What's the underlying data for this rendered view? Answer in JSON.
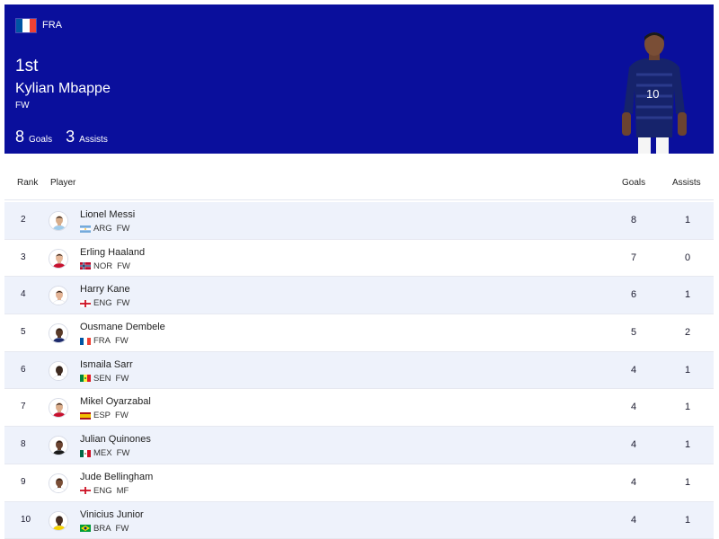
{
  "hero": {
    "country_code": "FRA",
    "rank": "1st",
    "name": "Kylian Mbappe",
    "position": "FW",
    "goals": "8",
    "goals_label": "Goals",
    "assists": "3",
    "assists_label": "Assists",
    "shirt_number": "10"
  },
  "table": {
    "headers": {
      "rank": "Rank",
      "player": "Player",
      "goals": "Goals",
      "assists": "Assists"
    },
    "rows": [
      {
        "rank": "2",
        "name": "Lionel Messi",
        "country": "ARG",
        "position": "FW",
        "goals": "8",
        "assists": "1",
        "flag": "ARG",
        "skin": "#d8ad8a",
        "shirt": "#9fcbea"
      },
      {
        "rank": "3",
        "name": "Erling Haaland",
        "country": "NOR",
        "position": "FW",
        "goals": "7",
        "assists": "0",
        "flag": "NOR",
        "skin": "#e6b89a",
        "shirt": "#c8102e"
      },
      {
        "rank": "4",
        "name": "Harry Kane",
        "country": "ENG",
        "position": "FW",
        "goals": "6",
        "assists": "1",
        "flag": "ENG",
        "skin": "#e3b394",
        "shirt": "#ffffff"
      },
      {
        "rank": "5",
        "name": "Ousmane Dembele",
        "country": "FRA",
        "position": "FW",
        "goals": "5",
        "assists": "2",
        "flag": "FRA",
        "skin": "#5a3a28",
        "shirt": "#1c2a6b"
      },
      {
        "rank": "6",
        "name": "Ismaila Sarr",
        "country": "SEN",
        "position": "FW",
        "goals": "4",
        "assists": "1",
        "flag": "SEN",
        "skin": "#3e2a20",
        "shirt": "#ffffff"
      },
      {
        "rank": "7",
        "name": "Mikel Oyarzabal",
        "country": "ESP",
        "position": "FW",
        "goals": "4",
        "assists": "1",
        "flag": "ESP",
        "skin": "#dcae8c",
        "shirt": "#c8102e"
      },
      {
        "rank": "8",
        "name": "Julian Quinones",
        "country": "MEX",
        "position": "FW",
        "goals": "4",
        "assists": "1",
        "flag": "MEX",
        "skin": "#6b4330",
        "shirt": "#1a1a1a"
      },
      {
        "rank": "9",
        "name": "Jude Bellingham",
        "country": "ENG",
        "position": "MF",
        "goals": "4",
        "assists": "1",
        "flag": "ENG",
        "skin": "#7a4e36",
        "shirt": "#ffffff"
      },
      {
        "rank": "10",
        "name": "Vinicius Junior",
        "country": "BRA",
        "position": "FW",
        "goals": "4",
        "assists": "1",
        "flag": "BRA",
        "skin": "#4a3024",
        "shirt": "#f5d200"
      }
    ]
  },
  "colors": {
    "hero_bg": "#0a0f9c",
    "row_alt": "#eef2fb",
    "france_blue": "#0055a4",
    "france_red": "#ef4135"
  }
}
